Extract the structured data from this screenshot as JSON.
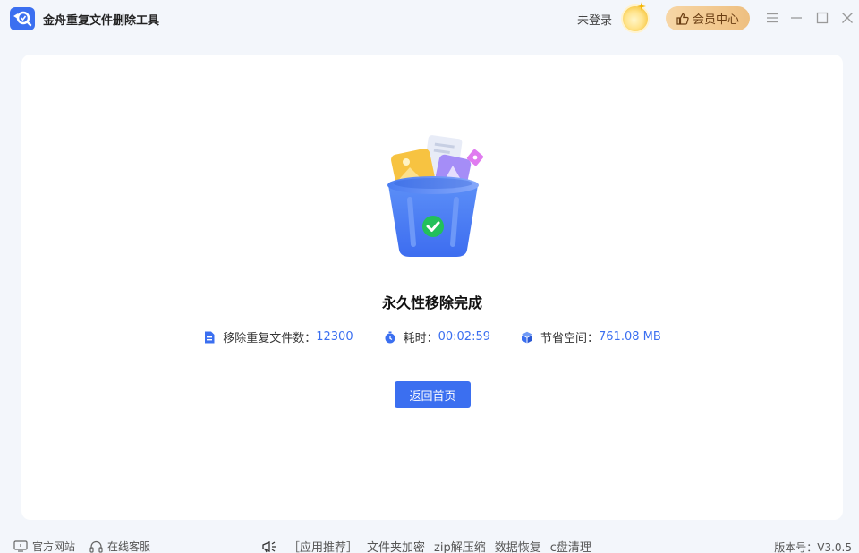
{
  "app": {
    "title": "金舟重复文件删除工具"
  },
  "header": {
    "login_text": "未登录",
    "vip_label": "会员中心"
  },
  "result": {
    "title": "永久性移除完成",
    "stats": [
      {
        "icon": "document-icon",
        "label": "移除重复文件数：",
        "value": "12300"
      },
      {
        "icon": "stopwatch-icon",
        "label": "耗时：",
        "value": "00:02:59"
      },
      {
        "icon": "cube-icon",
        "label": "节省空间：",
        "value": "761.08 MB"
      }
    ],
    "home_button": "返回首页"
  },
  "footer": {
    "website": "官方网站",
    "support": "在线客服",
    "recommend_label": "［应用推荐］",
    "recommend_links": [
      "文件夹加密",
      "zip解压缩",
      "数据恢复",
      "c盘清理"
    ],
    "version": "版本号：V3.0.5"
  },
  "colors": {
    "accent": "#3b6ff0",
    "success": "#22c05a",
    "vip_gradient_start": "#f7d6a6",
    "vip_gradient_end": "#eebf80"
  }
}
